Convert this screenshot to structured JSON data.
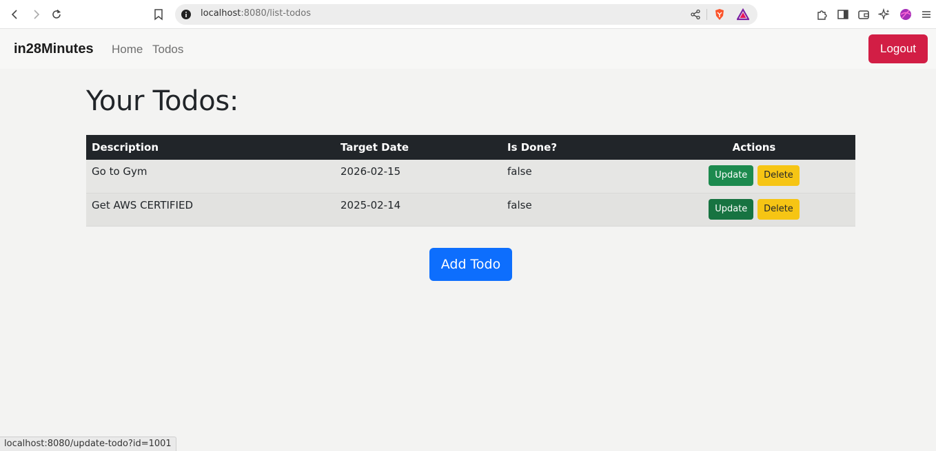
{
  "browser": {
    "url_host": "localhost",
    "url_rest": ":8080/list-todos",
    "status_url": "localhost:8080/update-todo?id=1001"
  },
  "navbar": {
    "brand": "in28Minutes",
    "links": [
      "Home",
      "Todos"
    ],
    "logout_label": "Logout"
  },
  "page": {
    "title": "Your Todos:"
  },
  "table": {
    "headers": [
      "Description",
      "Target Date",
      "Is Done?",
      "Actions"
    ],
    "rows": [
      {
        "description": "Go to Gym",
        "target_date": "2026-02-15",
        "is_done": "false",
        "update_label": "Update",
        "delete_label": "Delete"
      },
      {
        "description": "Get AWS CERTIFIED",
        "target_date": "2025-02-14",
        "is_done": "false",
        "update_label": "Update",
        "delete_label": "Delete"
      }
    ]
  },
  "add_todo_label": "Add Todo",
  "colors": {
    "logout": "#d21e45",
    "update": "#1c8a4e",
    "delete": "#f6c514",
    "add_todo": "#0d6efd",
    "table_header": "#212529"
  }
}
